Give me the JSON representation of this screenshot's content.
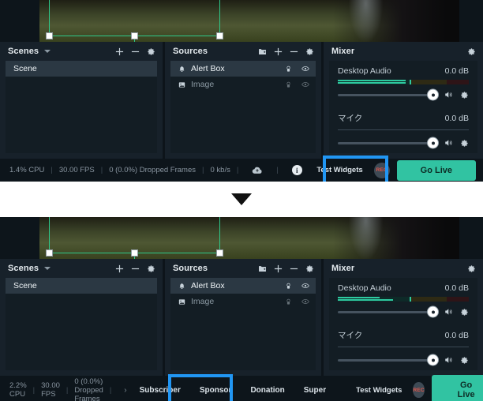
{
  "app": {
    "scenes_panel": {
      "title": "Scenes",
      "caret_icon": "chevron-down-icon",
      "actions": [
        "plus-icon",
        "minus-icon",
        "gear-icon"
      ],
      "items": [
        {
          "label": "Scene",
          "selected": true
        }
      ]
    },
    "sources_panel": {
      "title": "Sources",
      "actions": [
        "add-folder-icon",
        "plus-icon",
        "minus-icon",
        "gear-icon"
      ],
      "items": [
        {
          "label": "Alert Box",
          "icon": "bell-icon",
          "selected": true,
          "lock_icon": "lock-icon",
          "visibility_icon": "eye-icon"
        },
        {
          "label": "Image",
          "icon": "image-icon",
          "selected": false,
          "lock_icon": "lock-icon",
          "visibility_icon": "eye-icon"
        }
      ]
    },
    "mixer_panel": {
      "title": "Mixer",
      "gear_icon": "gear-icon",
      "channels": [
        {
          "name": "Desktop Audio",
          "db": "0.0 dB",
          "meter_level_top_pct": 52,
          "meter_level_bottom_pct": 52,
          "peak_tick_pct": 55,
          "speaker_icon": "speaker-icon",
          "settings_icon": "gear-icon"
        },
        {
          "name": "マイク",
          "db": "0.0 dB",
          "meter_level_top_pct": 0,
          "meter_level_bottom_pct": 0,
          "peak_tick_pct": 0,
          "speaker_icon": "speaker-icon",
          "settings_icon": "gear-icon"
        }
      ]
    },
    "statusbar": {
      "cpu": "1.4% CPU",
      "fps": "30.00 FPS",
      "dropped": "0 (0.0%) Dropped Frames",
      "bitrate": "0 kb/s",
      "cloud_icon": "cloud-icon",
      "info_icon": "info-icon",
      "test_widgets_label": "Test Widgets",
      "rec_label": "REC",
      "go_live_label": "Go Live"
    }
  },
  "app_bottom": {
    "scenes_panel": {
      "title": "Scenes",
      "caret_icon": "chevron-down-icon",
      "items": [
        {
          "label": "Scene",
          "selected": true
        }
      ]
    },
    "sources_panel": {
      "title": "Sources",
      "items": [
        {
          "label": "Alert Box",
          "icon": "bell-icon",
          "selected": true
        },
        {
          "label": "Image",
          "icon": "image-icon",
          "selected": false
        }
      ]
    },
    "mixer_panel": {
      "title": "Mixer",
      "channels": [
        {
          "name": "Desktop Audio",
          "db": "0.0 dB",
          "meter_level_top_pct": 32,
          "meter_level_bottom_pct": 42,
          "peak_tick_pct": 55
        },
        {
          "name": "マイク",
          "db": "0.0 dB",
          "meter_level_top_pct": 0,
          "meter_level_bottom_pct": 0,
          "peak_tick_pct": 0
        }
      ]
    },
    "statusbar": {
      "cpu": "2.2% CPU",
      "fps": "30.00 FPS",
      "dropped": "0 (0.0%) Dropped Frames",
      "prev_arrow": "›",
      "tabs": [
        "Subscriber",
        "Sponsor",
        "Donation",
        "Super"
      ],
      "test_widgets_label": "Test Widgets",
      "rec_label": "REC",
      "go_live_label": "Go Live"
    }
  },
  "divider": {
    "arrow_icon": "arrow-down-icon"
  },
  "colors": {
    "accent_go_live": "#31c3a2",
    "highlight_border": "#2196f3",
    "panel_bg": "#17212a",
    "panel_body_bg": "#131d24",
    "meter_green": "#2ec9a0",
    "selection_box": "#2ec98a",
    "rec_red": "#e2564a"
  }
}
